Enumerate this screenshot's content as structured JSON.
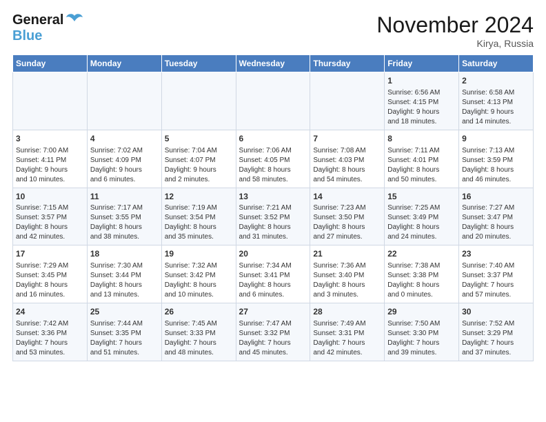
{
  "header": {
    "logo_general": "General",
    "logo_blue": "Blue",
    "month_title": "November 2024",
    "location": "Kirya, Russia"
  },
  "days_of_week": [
    "Sunday",
    "Monday",
    "Tuesday",
    "Wednesday",
    "Thursday",
    "Friday",
    "Saturday"
  ],
  "weeks": [
    [
      {
        "day": "",
        "info": ""
      },
      {
        "day": "",
        "info": ""
      },
      {
        "day": "",
        "info": ""
      },
      {
        "day": "",
        "info": ""
      },
      {
        "day": "",
        "info": ""
      },
      {
        "day": "1",
        "info": "Sunrise: 6:56 AM\nSunset: 4:15 PM\nDaylight: 9 hours\nand 18 minutes."
      },
      {
        "day": "2",
        "info": "Sunrise: 6:58 AM\nSunset: 4:13 PM\nDaylight: 9 hours\nand 14 minutes."
      }
    ],
    [
      {
        "day": "3",
        "info": "Sunrise: 7:00 AM\nSunset: 4:11 PM\nDaylight: 9 hours\nand 10 minutes."
      },
      {
        "day": "4",
        "info": "Sunrise: 7:02 AM\nSunset: 4:09 PM\nDaylight: 9 hours\nand 6 minutes."
      },
      {
        "day": "5",
        "info": "Sunrise: 7:04 AM\nSunset: 4:07 PM\nDaylight: 9 hours\nand 2 minutes."
      },
      {
        "day": "6",
        "info": "Sunrise: 7:06 AM\nSunset: 4:05 PM\nDaylight: 8 hours\nand 58 minutes."
      },
      {
        "day": "7",
        "info": "Sunrise: 7:08 AM\nSunset: 4:03 PM\nDaylight: 8 hours\nand 54 minutes."
      },
      {
        "day": "8",
        "info": "Sunrise: 7:11 AM\nSunset: 4:01 PM\nDaylight: 8 hours\nand 50 minutes."
      },
      {
        "day": "9",
        "info": "Sunrise: 7:13 AM\nSunset: 3:59 PM\nDaylight: 8 hours\nand 46 minutes."
      }
    ],
    [
      {
        "day": "10",
        "info": "Sunrise: 7:15 AM\nSunset: 3:57 PM\nDaylight: 8 hours\nand 42 minutes."
      },
      {
        "day": "11",
        "info": "Sunrise: 7:17 AM\nSunset: 3:55 PM\nDaylight: 8 hours\nand 38 minutes."
      },
      {
        "day": "12",
        "info": "Sunrise: 7:19 AM\nSunset: 3:54 PM\nDaylight: 8 hours\nand 35 minutes."
      },
      {
        "day": "13",
        "info": "Sunrise: 7:21 AM\nSunset: 3:52 PM\nDaylight: 8 hours\nand 31 minutes."
      },
      {
        "day": "14",
        "info": "Sunrise: 7:23 AM\nSunset: 3:50 PM\nDaylight: 8 hours\nand 27 minutes."
      },
      {
        "day": "15",
        "info": "Sunrise: 7:25 AM\nSunset: 3:49 PM\nDaylight: 8 hours\nand 24 minutes."
      },
      {
        "day": "16",
        "info": "Sunrise: 7:27 AM\nSunset: 3:47 PM\nDaylight: 8 hours\nand 20 minutes."
      }
    ],
    [
      {
        "day": "17",
        "info": "Sunrise: 7:29 AM\nSunset: 3:45 PM\nDaylight: 8 hours\nand 16 minutes."
      },
      {
        "day": "18",
        "info": "Sunrise: 7:30 AM\nSunset: 3:44 PM\nDaylight: 8 hours\nand 13 minutes."
      },
      {
        "day": "19",
        "info": "Sunrise: 7:32 AM\nSunset: 3:42 PM\nDaylight: 8 hours\nand 10 minutes."
      },
      {
        "day": "20",
        "info": "Sunrise: 7:34 AM\nSunset: 3:41 PM\nDaylight: 8 hours\nand 6 minutes."
      },
      {
        "day": "21",
        "info": "Sunrise: 7:36 AM\nSunset: 3:40 PM\nDaylight: 8 hours\nand 3 minutes."
      },
      {
        "day": "22",
        "info": "Sunrise: 7:38 AM\nSunset: 3:38 PM\nDaylight: 8 hours\nand 0 minutes."
      },
      {
        "day": "23",
        "info": "Sunrise: 7:40 AM\nSunset: 3:37 PM\nDaylight: 7 hours\nand 57 minutes."
      }
    ],
    [
      {
        "day": "24",
        "info": "Sunrise: 7:42 AM\nSunset: 3:36 PM\nDaylight: 7 hours\nand 53 minutes."
      },
      {
        "day": "25",
        "info": "Sunrise: 7:44 AM\nSunset: 3:35 PM\nDaylight: 7 hours\nand 51 minutes."
      },
      {
        "day": "26",
        "info": "Sunrise: 7:45 AM\nSunset: 3:33 PM\nDaylight: 7 hours\nand 48 minutes."
      },
      {
        "day": "27",
        "info": "Sunrise: 7:47 AM\nSunset: 3:32 PM\nDaylight: 7 hours\nand 45 minutes."
      },
      {
        "day": "28",
        "info": "Sunrise: 7:49 AM\nSunset: 3:31 PM\nDaylight: 7 hours\nand 42 minutes."
      },
      {
        "day": "29",
        "info": "Sunrise: 7:50 AM\nSunset: 3:30 PM\nDaylight: 7 hours\nand 39 minutes."
      },
      {
        "day": "30",
        "info": "Sunrise: 7:52 AM\nSunset: 3:29 PM\nDaylight: 7 hours\nand 37 minutes."
      }
    ]
  ]
}
